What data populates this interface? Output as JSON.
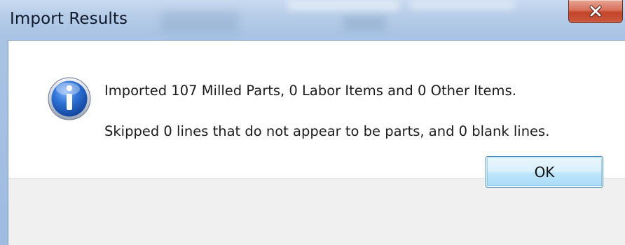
{
  "window": {
    "title": "Import Results",
    "close_icon": "close-x-icon"
  },
  "message": {
    "icon": "information-icon",
    "line1": "Imported 107 Milled Parts, 0 Labor Items and 0 Other Items.",
    "line2": "Skipped 0 lines that do not appear to be parts, and 0 blank lines."
  },
  "buttons": {
    "ok_label": "OK"
  },
  "colors": {
    "titlebar": "#a9c3e4",
    "close_button": "#c9583e",
    "ok_button_border": "#3c7fb1",
    "button_area": "#f0f0f0",
    "info_icon": "#1f63c2"
  }
}
